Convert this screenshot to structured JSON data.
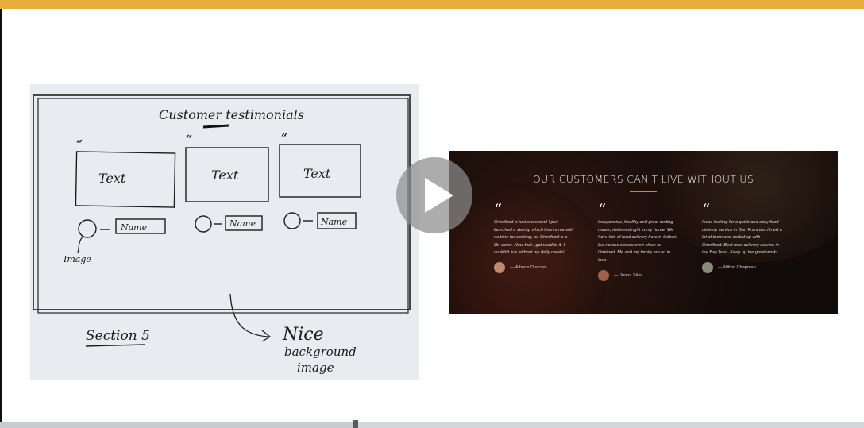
{
  "sketch": {
    "title": "Customer testimonials",
    "box_text": [
      "Text",
      "Text",
      "Text"
    ],
    "name_text": [
      "Name",
      "Name",
      "Name"
    ],
    "image_note": "Image",
    "section_label": "Section 5",
    "note_line1": "Nice",
    "note_line2": "background",
    "note_line3": "image"
  },
  "screenshot": {
    "title": "OUR CUSTOMERS CAN'T LIVE WITHOUT US",
    "quote_mark": "“",
    "testimonials": [
      {
        "lines": [
          "Omnifood is just awesome! I just",
          "launched a startup which leaves me with",
          "no time for cooking, so Omnifood is a",
          "life-saver. Now that I got used to it, I",
          "couldn't live without my daily meals!"
        ],
        "author": "— Alberto Duncan"
      },
      {
        "lines": [
          "Inexpensive, healthy and great-tasting",
          "meals, delivered right to my home. We",
          "have lots of food delivery here in Lisbon,",
          "but no one comes even close to",
          "Omifood. Me and my family are so in",
          "love!"
        ],
        "author": "— Joana Silva"
      },
      {
        "lines": [
          "I was looking for a quick and easy food",
          "delivery service in San Franciso. I tried a",
          "lot of them and ended up with",
          "Omnifood. Best food delivery service in",
          "the Bay Area. Keep up the great work!"
        ],
        "author": "— Milton Chapman"
      }
    ]
  },
  "player": {
    "play_icon": "play-icon",
    "progress": 0.412
  },
  "colors": {
    "accent": "#e67e22",
    "top_band": "#e8ae3b"
  }
}
